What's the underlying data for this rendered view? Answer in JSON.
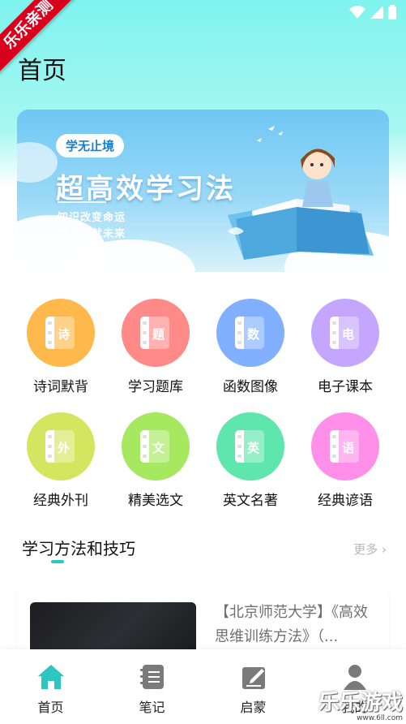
{
  "status_bar": {
    "icons": [
      "wifi-icon",
      "signal-icon",
      "battery-icon"
    ]
  },
  "ribbon": {
    "text": "乐乐亲测"
  },
  "header": {
    "title": "首页"
  },
  "banner": {
    "pill": "学无止境",
    "title": "超高效学习法",
    "sub1": "知识改变命运",
    "sub2": "学习成就未来"
  },
  "categories": [
    {
      "label": "诗词默背",
      "glyph": "诗",
      "color": "#ffb84a"
    },
    {
      "label": "学习题库",
      "glyph": "题",
      "color": "#ff8a88"
    },
    {
      "label": "函数图像",
      "glyph": "数",
      "color": "#80b0ff"
    },
    {
      "label": "电子课本",
      "glyph": "电",
      "color": "#c4a6ff"
    },
    {
      "label": "经典外刊",
      "glyph": "外",
      "color": "#d4e660"
    },
    {
      "label": "精美选文",
      "glyph": "文",
      "color": "#a6e860"
    },
    {
      "label": "英文名著",
      "glyph": "英",
      "color": "#5fe6ad"
    },
    {
      "label": "经典谚语",
      "glyph": "语",
      "color": "#ff8fe8"
    }
  ],
  "section": {
    "title": "学习方法和技巧",
    "more": "更多 ›"
  },
  "article": {
    "title": "【北京师范大学】《高效思维训练方法》（..."
  },
  "tabs": [
    {
      "label": "首页",
      "icon": "home-icon",
      "active": true
    },
    {
      "label": "笔记",
      "icon": "notebook-icon",
      "active": false
    },
    {
      "label": "启蒙",
      "icon": "edit-icon",
      "active": false
    },
    {
      "label": "我的",
      "icon": "user-icon",
      "active": false
    }
  ],
  "watermark": {
    "main": "乐乐游戏",
    "sub": "www.6ll.com"
  },
  "colors": {
    "accent": "#2ec7c0",
    "header_bg": "#7ff3ee"
  }
}
